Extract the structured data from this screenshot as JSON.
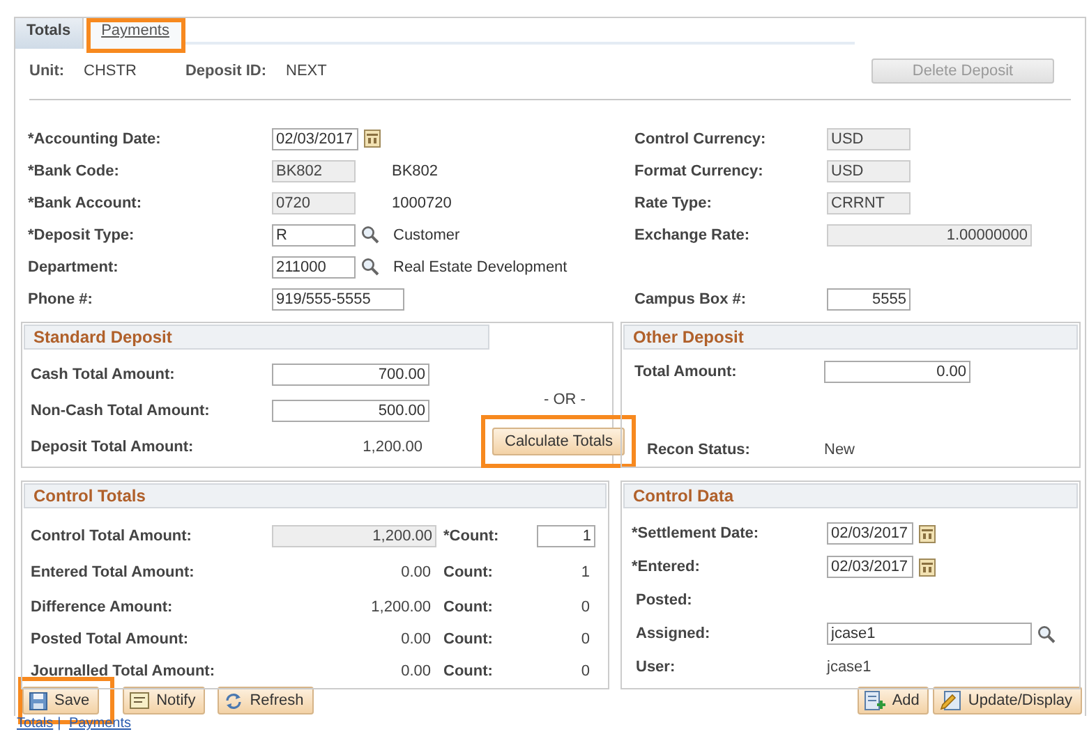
{
  "tabs": [
    {
      "label": "Totals",
      "selected": true,
      "highlighted": false
    },
    {
      "label": "Payments",
      "selected": false,
      "highlighted": true
    }
  ],
  "header": {
    "fields": [
      {
        "label": "Unit:",
        "value": "CHSTR"
      },
      {
        "label": "Deposit ID:",
        "value": "NEXT"
      }
    ],
    "delete_button": {
      "label": "Delete Deposit",
      "disabled": true
    }
  },
  "detail_rows": [
    {
      "left": {
        "label": "*Accounting Date:",
        "kind": "date",
        "value": "02/03/2017"
      },
      "right": {
        "label": "Control Currency:",
        "kind": "readonly",
        "value": "USD"
      }
    },
    {
      "left": {
        "label": "*Bank Code:",
        "kind": "readonly",
        "value": "BK802",
        "description": "BK802"
      },
      "right": {
        "label": "Format Currency:",
        "kind": "readonly",
        "value": "USD"
      }
    },
    {
      "left": {
        "label": "*Bank Account:",
        "kind": "readonly",
        "value": "0720",
        "description": "1000720"
      },
      "right": {
        "label": "Rate Type:",
        "kind": "readonly",
        "value": "CRRNT"
      }
    },
    {
      "left": {
        "label": "*Deposit Type:",
        "kind": "lookup",
        "value": "R",
        "description": "Customer"
      },
      "right": {
        "label": "Exchange Rate:",
        "kind": "readonly_number",
        "value": "1.00000000"
      }
    },
    {
      "left": {
        "label": "Department:",
        "kind": "lookup",
        "value": "211000",
        "description": "Real Estate Development"
      }
    },
    {
      "left": {
        "label": "Phone #:",
        "kind": "text",
        "value": "919/555-5555"
      },
      "right": {
        "label": "Campus Box #:",
        "kind": "number",
        "value": "5555"
      }
    }
  ],
  "standard_deposit": {
    "title": "Standard Deposit",
    "rows": [
      {
        "label": "Cash Total Amount:",
        "kind": "number",
        "value": "700.00"
      },
      {
        "label": "Non-Cash Total Amount:",
        "kind": "number",
        "value": "500.00"
      },
      {
        "label": "Deposit Total Amount:",
        "kind": "display_number",
        "value": "1,200.00"
      }
    ]
  },
  "or_text": "- OR -",
  "calculate_button": {
    "label": "Calculate Totals",
    "highlighted": true
  },
  "other_deposit": {
    "title": "Other Deposit",
    "rows": [
      {
        "label": "Total Amount:",
        "kind": "number",
        "value": "0.00"
      }
    ],
    "recon_status_label": "Recon Status:",
    "recon_status": "New"
  },
  "control_totals": {
    "title": "Control Totals",
    "rows": [
      {
        "label": "Control Total Amount:",
        "kind": "readonly_number",
        "value": "1,200.00",
        "count_label": "*Count:",
        "count": {
          "kind": "number",
          "value": "1"
        }
      },
      {
        "label": "Entered Total Amount:",
        "kind": "display_number",
        "value": "0.00",
        "count_label": "Count:",
        "count": {
          "kind": "display_number",
          "value": "1"
        }
      },
      {
        "label": "Difference Amount:",
        "kind": "display_number",
        "value": "1,200.00",
        "count_label": "Count:",
        "count": {
          "kind": "display_number",
          "value": "0"
        }
      },
      {
        "label": "Posted Total Amount:",
        "kind": "display_number",
        "value": "0.00",
        "count_label": "Count:",
        "count": {
          "kind": "display_number",
          "value": "0"
        }
      },
      {
        "label": "Journalled Total Amount:",
        "kind": "display_number",
        "value": "0.00",
        "count_label": "Count:",
        "count": {
          "kind": "display_number",
          "value": "0"
        }
      }
    ]
  },
  "control_data": {
    "title": "Control Data",
    "rows": [
      {
        "label": "*Settlement Date:",
        "kind": "date",
        "value": "02/03/2017"
      },
      {
        "label": "*Entered:",
        "kind": "date",
        "value": "02/03/2017"
      },
      {
        "label": "Posted:",
        "kind": "label_only"
      },
      {
        "label": "Assigned:",
        "kind": "lookup",
        "value": "jcase1"
      },
      {
        "label": "User:",
        "kind": "display",
        "value": "jcase1"
      }
    ]
  },
  "left_buttons": [
    {
      "label": "Save",
      "kind": "save",
      "highlighted": true
    },
    {
      "label": "Notify",
      "kind": "notify",
      "highlighted": false
    },
    {
      "label": "Refresh",
      "kind": "refresh",
      "highlighted": false
    }
  ],
  "right_buttons": [
    {
      "label": "Add",
      "kind": "add"
    },
    {
      "label": "Update/Display",
      "kind": "update"
    }
  ],
  "footer_links": [
    {
      "label": "Totals"
    },
    {
      "label": "Payments"
    }
  ],
  "footer_separator": "|"
}
